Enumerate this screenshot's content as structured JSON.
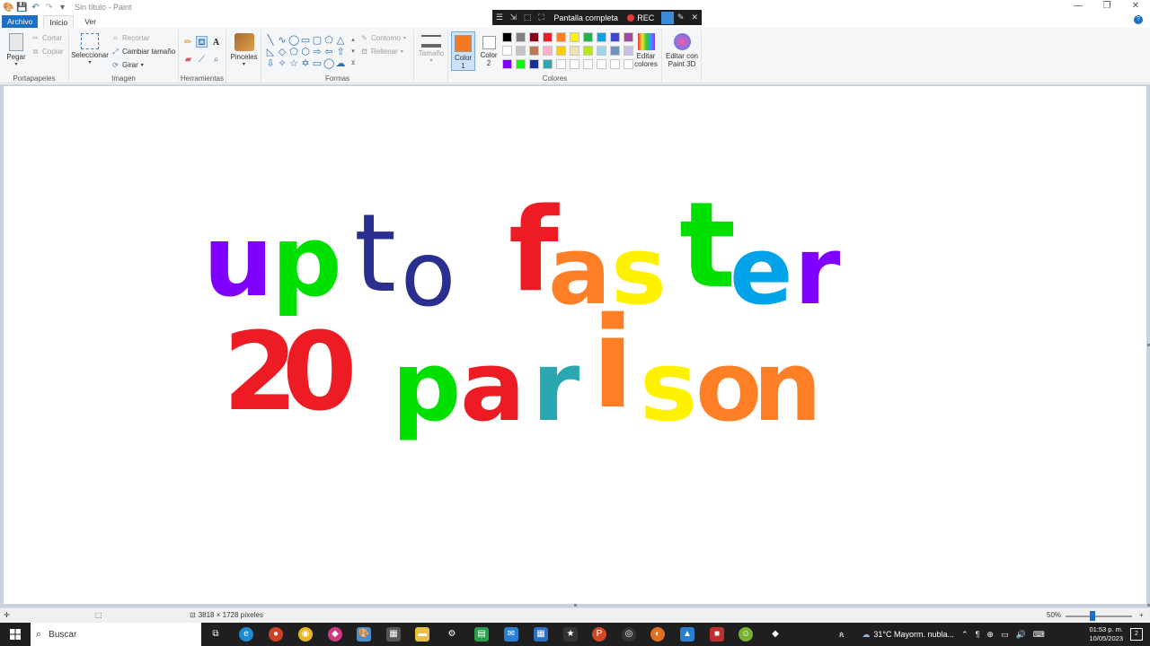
{
  "window": {
    "title": "Sin título - Paint",
    "controls": [
      "—",
      "❐",
      "✕"
    ]
  },
  "recorder": {
    "fullscreen_label": "Pantalla completa",
    "rec_label": "REC"
  },
  "tabs": [
    {
      "label": "Archivo"
    },
    {
      "label": "Inicio"
    },
    {
      "label": "Ver"
    }
  ],
  "ribbon": {
    "portapapeles": {
      "paste": "Pegar",
      "cut": "Cortar",
      "copy": "Copiar",
      "group": "Portapapeles"
    },
    "imagen": {
      "select": "Seleccionar",
      "crop": "Recortar",
      "resize": "Cambiar tamaño",
      "rotate": "Girar",
      "group": "Imagen"
    },
    "herramientas": {
      "group": "Herramientas"
    },
    "pinceles": {
      "label": "Pinceles"
    },
    "formas": {
      "outline": "Contorno",
      "fill": "Rellenar",
      "group": "Formas"
    },
    "tamano": {
      "label": "Tamaño"
    },
    "colores": {
      "color1": "Color 1",
      "color2": "Color 2",
      "color1_value": "#f47920",
      "color2_value": "#ffffff",
      "edit": "Editar colores",
      "edit3d": "Editar con Paint 3D",
      "group": "Colores",
      "palette_row1": [
        "#000000",
        "#7f7f7f",
        "#880015",
        "#ed1c24",
        "#ff7f27",
        "#fff200",
        "#22b14c",
        "#00a2e8",
        "#3f48cc",
        "#a349a4"
      ],
      "palette_row2": [
        "#ffffff",
        "#c3c3c3",
        "#b97a57",
        "#ffaec9",
        "#ffc90e",
        "#efe4b0",
        "#b5e61d",
        "#99d9ea",
        "#7092be",
        "#c8bfe7"
      ],
      "palette_row3": [
        "#8000ff",
        "#00ff00",
        "#1f2f8f",
        "#2aa7b0",
        "#ffffff",
        "#ffffff",
        "#ffffff",
        "#ffffff",
        "#ffffff",
        "#ffffff"
      ]
    }
  },
  "drawing": {
    "line1": [
      {
        "text": "u",
        "color": "#8000ff"
      },
      {
        "text": "p",
        "color": "#00e000"
      },
      {
        "text": "t",
        "color": "#2a2f8f"
      },
      {
        "text": "o",
        "color": "#2a2f8f"
      },
      {
        "text": "f",
        "color": "#ed1c24"
      },
      {
        "text": "a",
        "color": "#ff7f27"
      },
      {
        "text": "s",
        "color": "#fff200"
      },
      {
        "text": "t",
        "color": "#00e000"
      },
      {
        "text": "e",
        "color": "#00a2e8"
      },
      {
        "text": "r",
        "color": "#8000ff"
      }
    ],
    "line2": [
      {
        "text": "2",
        "color": "#ed1c24"
      },
      {
        "text": "0",
        "color": "#ed1c24"
      },
      {
        "text": "p",
        "color": "#00e000"
      },
      {
        "text": "a",
        "color": "#ed1c24"
      },
      {
        "text": "r",
        "color": "#2aa7b0"
      },
      {
        "text": "i",
        "color": "#ff7f27"
      },
      {
        "text": "s",
        "color": "#fff200"
      },
      {
        "text": "o",
        "color": "#ff7f27"
      },
      {
        "text": "n",
        "color": "#ff7f27"
      }
    ]
  },
  "status": {
    "dimensions": "3818 × 1728 píxeles",
    "zoom": "50%"
  },
  "taskbar": {
    "search_placeholder": "Buscar",
    "weather": "31°C  Mayorm. nubla...",
    "time": "01:53 p. m.",
    "date": "10/05/2023"
  }
}
